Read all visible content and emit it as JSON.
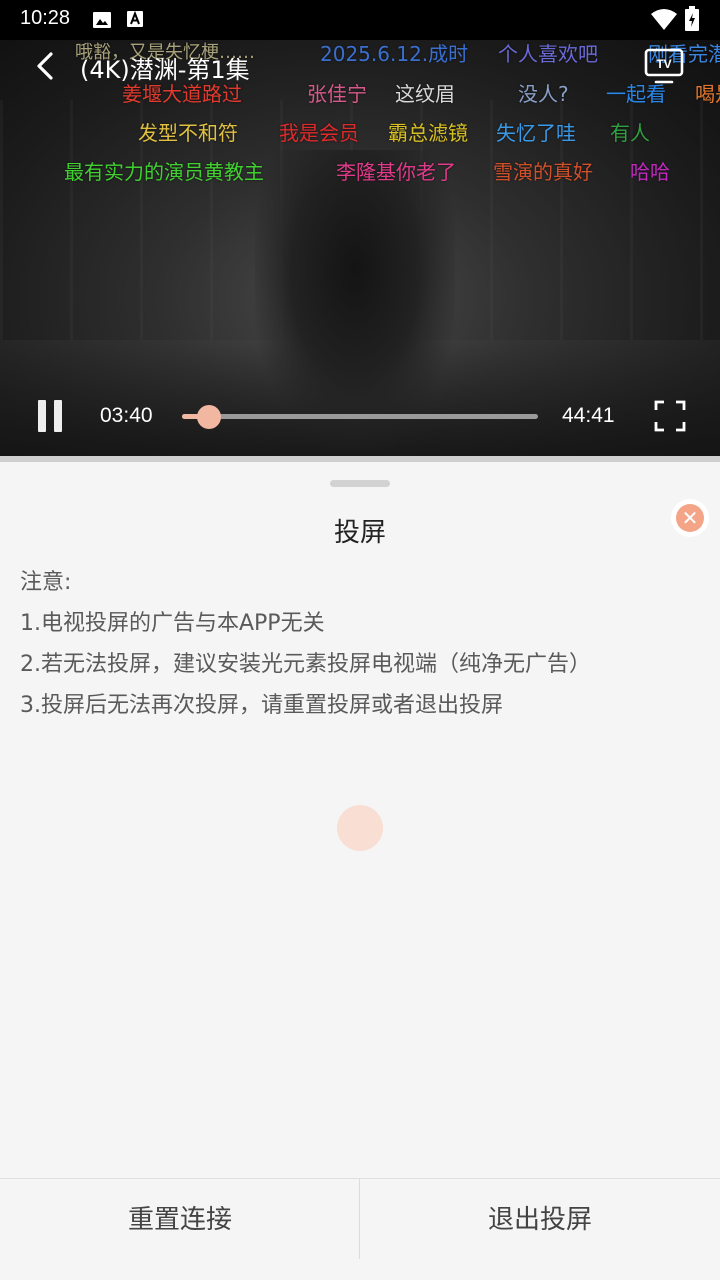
{
  "status_bar": {
    "time": "10:28",
    "icons": [
      "image-icon",
      "accessibility-a-icon",
      "wifi-icon",
      "battery-icon"
    ]
  },
  "player": {
    "title": "(4K)潜渊-第1集",
    "back_icon": "chevron-left-icon",
    "cast_icon": "tv-icon",
    "current_time": "03:40",
    "total_time": "44:41",
    "progress": 0.076,
    "state": "playing",
    "danmaku": [
      {
        "text": "哦豁，又是失忆梗……",
        "color": "#a8a27a"
      },
      {
        "text": "2025.6.12.成时",
        "color": "#3a6fd0"
      },
      {
        "text": "个人喜欢吧",
        "color": "#6a6ad8"
      },
      {
        "text": "刚看完潜",
        "color": "#3a86e0"
      },
      {
        "text": "姜堰大道路过",
        "color": "#e03b2e"
      },
      {
        "text": "张佳宁",
        "color": "#d85a8a"
      },
      {
        "text": "这纹眉",
        "color": "#d8d8d8"
      },
      {
        "text": "没人?",
        "color": "#8aa0c8"
      },
      {
        "text": "一起看",
        "color": "#2a86e8"
      },
      {
        "text": "喝是",
        "color": "#e0762e"
      },
      {
        "text": "发型不和符",
        "color": "#e0c040"
      },
      {
        "text": "我是会员",
        "color": "#e02a2a"
      },
      {
        "text": "霸总滤镜",
        "color": "#d8c020"
      },
      {
        "text": "失忆了哇",
        "color": "#3a9ae8"
      },
      {
        "text": "有人",
        "color": "#30a040"
      },
      {
        "text": "最有实力的演员黄教主",
        "color": "#40d030"
      },
      {
        "text": "李隆基你老了",
        "color": "#e03a8a"
      },
      {
        "text": "雪演的真好",
        "color": "#d0502a"
      },
      {
        "text": "哈哈",
        "color": "#c028c0"
      }
    ]
  },
  "sheet": {
    "title": "投屏",
    "close_icon": "close-x-icon",
    "notice_heading": "注意:",
    "notice_lines": [
      "1.电视投屏的广告与本APP无关",
      "2.若无法投屏，建议安装光元素投屏电视端（纯净无广告）",
      "3.投屏后无法再次投屏，请重置投屏或者退出投屏"
    ],
    "accent_color": "#f4a487",
    "reset_button": "重置连接",
    "exit_button": "退出投屏"
  }
}
